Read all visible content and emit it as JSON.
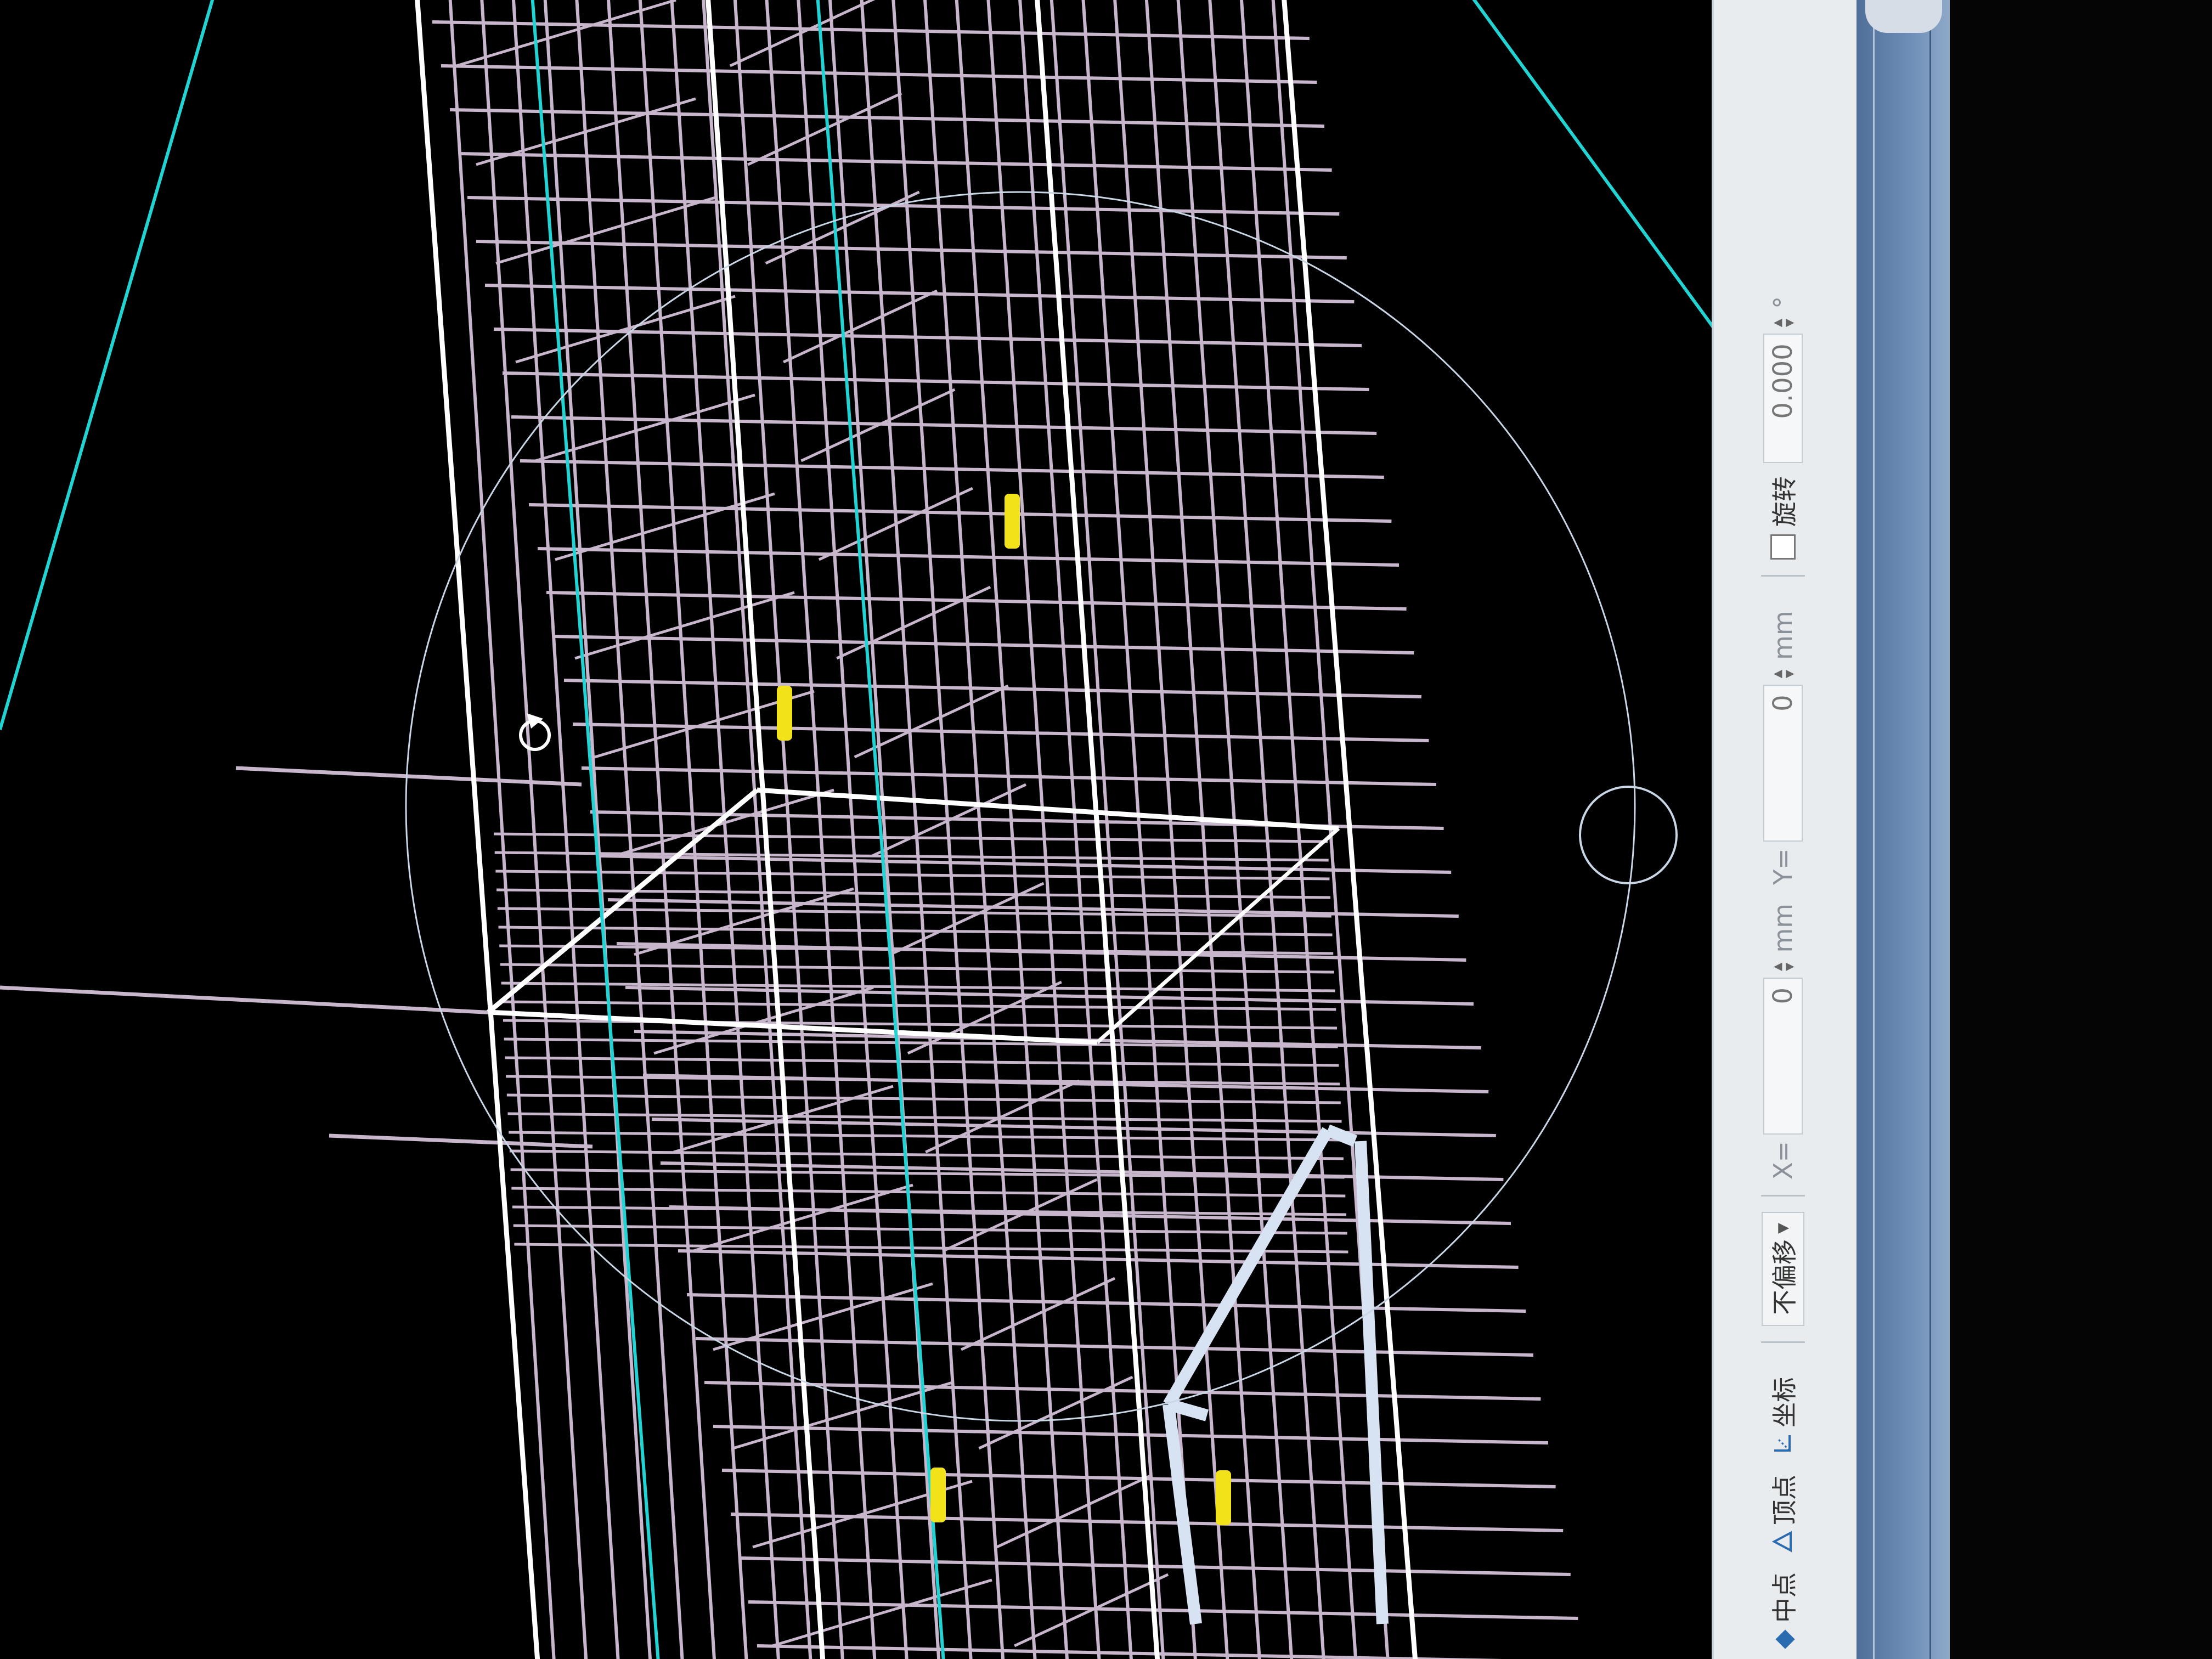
{
  "viewport": {
    "background": "#000000",
    "colors": {
      "rebar_mesh": "#c8b7cc",
      "outline": "#ffffff",
      "axis": "#22d3d3",
      "marker": "#f2e21a",
      "circle": "#c9d6e6",
      "frame": "#d7e3f2"
    },
    "markers": [
      "marker-1",
      "marker-2",
      "marker-3",
      "marker-4"
    ],
    "cursor_icon": "rotate-cursor-icon"
  },
  "status_bar": {
    "midpoint_label": "中点",
    "vertex_label": "顶点",
    "coordinate_label": "坐标",
    "offset_mode": "不偏移",
    "x_label": "X=",
    "x_value": "0",
    "x_unit": "mm",
    "y_label": "Y=",
    "y_value": "0",
    "y_unit": "mm",
    "rotate_label": "旋转",
    "rotate_value": "0.000",
    "rotate_checked": false
  }
}
